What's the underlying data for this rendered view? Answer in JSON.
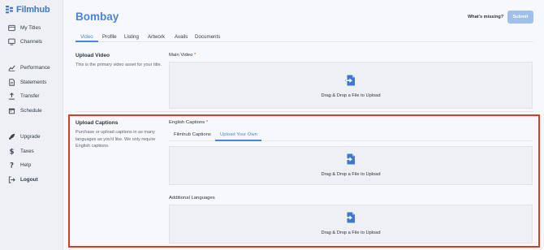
{
  "app": {
    "brand": "Filmhub",
    "brand_color": "#3f78c8"
  },
  "sidebar": {
    "items": [
      {
        "label": "My Titles",
        "icon": "titles-icon"
      },
      {
        "label": "Channels",
        "icon": "monitor-icon"
      },
      {
        "label": "Performance",
        "icon": "chart-icon"
      },
      {
        "label": "Statements",
        "icon": "document-icon"
      },
      {
        "label": "Transfer",
        "icon": "upload-icon"
      },
      {
        "label": "Schedule",
        "icon": "calendar-icon"
      },
      {
        "label": "Upgrade",
        "icon": "rocket-icon"
      },
      {
        "label": "Taxes",
        "icon": "dollar-icon"
      },
      {
        "label": "Help",
        "icon": "question-icon"
      },
      {
        "label": "Logout",
        "icon": "logout-icon"
      }
    ]
  },
  "header": {
    "title": "Bombay",
    "whats_missing": "What's missing?",
    "submit_label": "Submit"
  },
  "tabs": [
    {
      "label": "Video",
      "active": true
    },
    {
      "label": "Profile",
      "active": false
    },
    {
      "label": "Listing",
      "active": false
    },
    {
      "label": "Artwork",
      "active": false
    },
    {
      "label": "Avails",
      "active": false
    },
    {
      "label": "Documents",
      "active": false
    }
  ],
  "upload_video": {
    "title": "Upload Video",
    "description": "This is the primary video asset for your title.",
    "field_label": "Main Video",
    "required_mark": "*",
    "dropzone_text": "Drag & Drop a File to Upload"
  },
  "upload_captions": {
    "title": "Upload Captions",
    "description": "Purchase or upload captions in as many languages as you'd like. We only require English captions.",
    "field_label": "English Captions",
    "required_mark": "*",
    "subtabs": [
      {
        "label": "Filmhub Captions",
        "active": false
      },
      {
        "label": "Upload Your Own",
        "active": true
      }
    ],
    "dropzone_text": "Drag & Drop a File to Upload",
    "additional_label": "Additional Languages",
    "additional_dropzone_text": "Drag & Drop a File to Upload"
  },
  "colors": {
    "accent": "#4a86d2",
    "highlight": "#d93a2b",
    "submit_disabled": "#9fc0ea"
  }
}
